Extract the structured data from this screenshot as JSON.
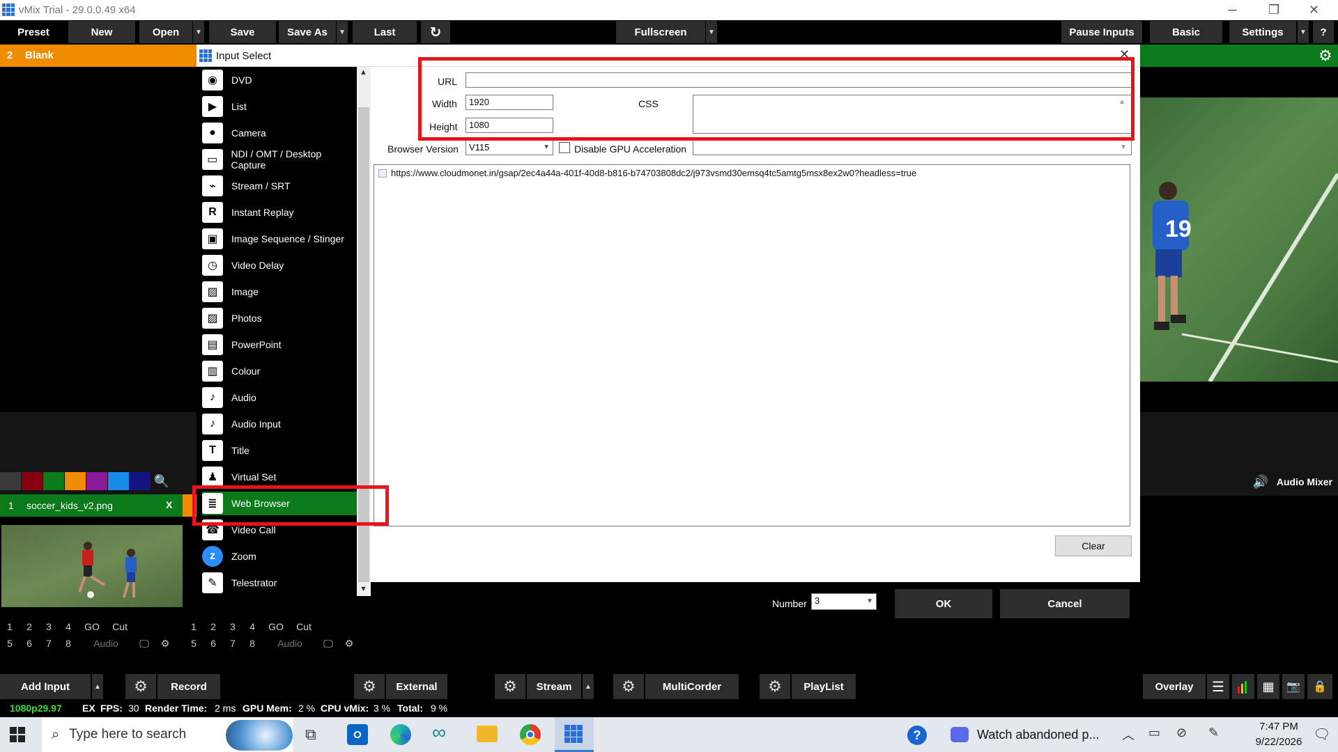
{
  "window": {
    "title": "vMix Trial - 29.0.0.49 x64"
  },
  "toolbar": {
    "preset": "Preset",
    "new": "New",
    "open": "Open",
    "save": "Save",
    "save_as": "Save As",
    "last": "Last",
    "fullscreen": "Fullscreen",
    "pause_inputs": "Pause Inputs",
    "basic": "Basic",
    "settings": "Settings",
    "help": "?"
  },
  "preset_bar": {
    "number": "2",
    "name": "Blank"
  },
  "dialog": {
    "title": "Input Select",
    "types": [
      "DVD",
      "List",
      "Camera",
      "NDI / OMT / Desktop Capture",
      "Stream / SRT",
      "Instant Replay",
      "Image Sequence / Stinger",
      "Video Delay",
      "Image",
      "Photos",
      "PowerPoint",
      "Colour",
      "Audio",
      "Audio Input",
      "Title",
      "Virtual Set",
      "Web Browser",
      "Video Call",
      "Zoom",
      "Telestrator"
    ],
    "selected": "Web Browser",
    "url_label": "URL",
    "url_value": "",
    "width_label": "Width",
    "width_value": "1920",
    "height_label": "Height",
    "height_value": "1080",
    "css_label": "CSS",
    "browser_version_label": "Browser Version",
    "browser_version_value": "V115",
    "disable_gpu_label": "Disable GPU Acceleration",
    "history_url": "https://www.cloudmonet.in/gsap/2ec4a44a-401f-40d8-b816-b74703808dc2/j973vsmd30emsq4tc5amtg5msx8ex2w0?headless=true",
    "clear": "Clear",
    "number_label": "Number",
    "number_value": "3",
    "ok": "OK",
    "cancel": "Cancel"
  },
  "inputs": {
    "number": "1",
    "name": "soccer_kids_v2.png",
    "close": "X",
    "row1": [
      "1",
      "2",
      "3",
      "4",
      "GO",
      "Cut"
    ],
    "row2": [
      "5",
      "6",
      "7",
      "8",
      "Audio"
    ],
    "row1b": [
      "1",
      "2",
      "3",
      "4",
      "GO",
      "Cut"
    ],
    "row2b": [
      "5",
      "6",
      "7",
      "8",
      "Audio"
    ]
  },
  "audio_mixer": "Audio Mixer",
  "bottom": {
    "add_input": "Add Input",
    "record": "Record",
    "external": "External",
    "stream": "Stream",
    "multicorder": "MultiCorder",
    "playlist": "PlayList",
    "overlay": "Overlay"
  },
  "status": {
    "format": "1080p29.97",
    "ex": "EX",
    "fps_label": "FPS:",
    "fps": "30",
    "render_label": "Render Time:",
    "render": "2 ms",
    "gpu_label": "GPU Mem:",
    "gpu": "2 %",
    "cpu_label": "CPU vMix:",
    "cpu": "3 %",
    "total_label": "Total:",
    "total": "9 %"
  },
  "taskbar": {
    "search": "Type here to search",
    "notification": "Watch abandoned p...",
    "time": "7:47 PM",
    "date": "9/22/2026"
  },
  "colors": {
    "accent_orange": "#f08c00",
    "accent_green": "#0a7a1a",
    "highlight_red": "#e8141a"
  }
}
